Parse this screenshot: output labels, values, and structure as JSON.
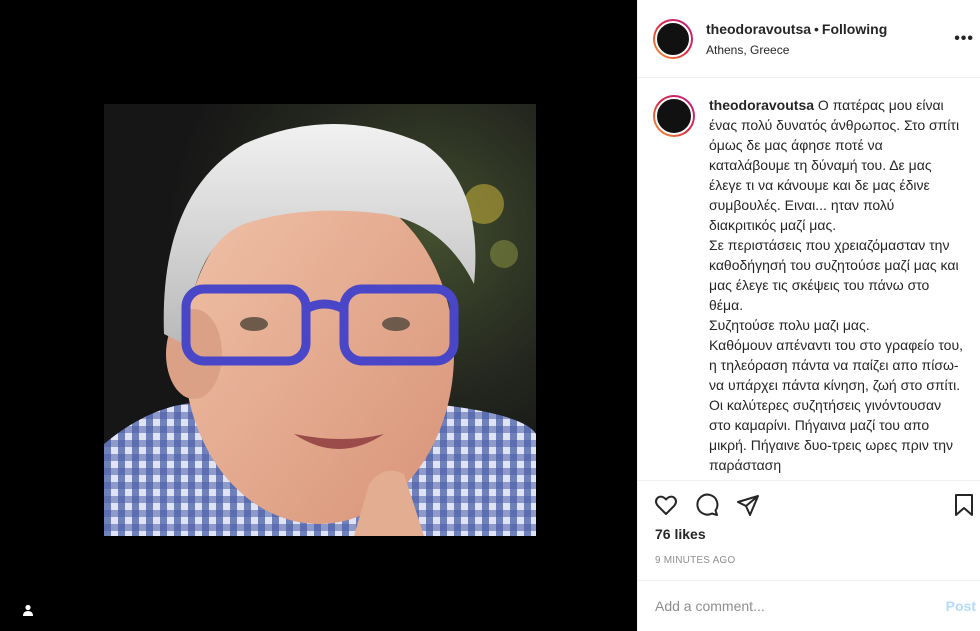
{
  "post": {
    "username": "theodoravoutsa",
    "separator": "•",
    "follow_status": "Following",
    "location": "Athens, Greece",
    "more_icon": "more-horizontal-icon",
    "caption_user": "theodoravoutsa",
    "caption": "Ο πατέρας μου είναι ένας πολύ δυνατός άνθρωπος. Στο σπίτι όμως δε μας άφησε ποτέ να καταλάβουμε τη δύναμή του. Δε μας έλεγε τι να κάνουμε και δε μας έδινε συμβουλές. Ειναι... ηταν πολύ διακριτικός μαζί μας.\nΣε περιστάσεις που χρειαζόμασταν την καθοδήγησή του συζητούσε μαζί μας και μας έλεγε τις σκέψεις του πάνω στο θέμα.\nΣυζητούσε πολυ μαζι μας.\nΚαθόμουν απέναντι του στο γραφείο του, η τηλεόραση πάντα να παίζει απο πίσω- να υπάρχει πάντα κίνηση, ζωή στο σπίτι.\nΟι καλύτερες συζητήσεις γινόντουσαν στο καμαρίνι. Πήγαινα μαζί του απο μικρή. Πήγαινε δυο-τρεις ωρες πριν την παράσταση",
    "likes": "76 likes",
    "timestamp": "9 MINUTES AGO",
    "comment_placeholder": "Add a comment...",
    "post_label": "Post"
  },
  "icons": {
    "like": "heart-icon",
    "comment": "comment-icon",
    "share": "share-icon",
    "save": "bookmark-icon",
    "user_tag": "user-icon"
  },
  "colors": {
    "avatar_gradient_start": "#f09433",
    "avatar_gradient_end": "#bc1888",
    "post_button": "#b3dbff",
    "muted_text": "#8e8e8e"
  }
}
